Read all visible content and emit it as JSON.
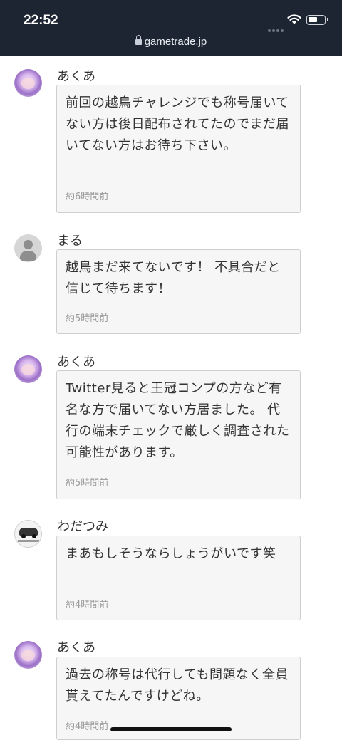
{
  "status_bar": {
    "time": "22:52",
    "url": "gametrade.jp",
    "signal_icon": "signal-dots-icon",
    "wifi_icon": "wifi-icon",
    "battery_icon": "battery-icon"
  },
  "comments": [
    {
      "user": "あくあ",
      "avatar": "anime-avatar",
      "text": "前回の越鳥チャレンジでも称号届いてない方は後日配布されてたのでまだ届いてない方はお待ち下さい。",
      "time": "約6時間前"
    },
    {
      "user": "まる",
      "avatar": "default-avatar",
      "text": "越鳥まだ来てないです！ 不具合だと信じて待ちます！",
      "time": "約5時間前"
    },
    {
      "user": "あくあ",
      "avatar": "anime-avatar",
      "text": "Twitter見ると王冠コンプの方など有名な方で届いてない方居ました。 代行の端末チェックで厳しく調査された可能性があります。",
      "time": "約5時間前"
    },
    {
      "user": "わだつみ",
      "avatar": "car-avatar",
      "text": "まあもしそうならしょうがいです笑",
      "time": "約4時間前"
    },
    {
      "user": "あくあ",
      "avatar": "anime-avatar",
      "text": "過去の称号は代行しても問題なく全員貰えてたんですけどね。",
      "time": "約4時間前"
    }
  ]
}
